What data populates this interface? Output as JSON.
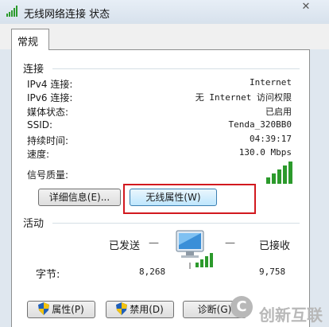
{
  "window": {
    "title": "无线网络连接 状态",
    "close_glyph": "✕"
  },
  "tabs": [
    {
      "label": "常规"
    }
  ],
  "connection": {
    "heading": "连接",
    "rows": [
      {
        "label": "IPv4 连接:",
        "value": "Internet"
      },
      {
        "label": "IPv6 连接:",
        "value": "无 Internet 访问权限"
      },
      {
        "label": "媒体状态:",
        "value": "已启用"
      },
      {
        "label": "SSID:",
        "value": "Tenda_320BB0"
      },
      {
        "label": "持续时间:",
        "value": "04:39:17"
      },
      {
        "label": "速度:",
        "value": "130.0 Mbps"
      }
    ],
    "signal_label": "信号质量:",
    "signal_bars": 5,
    "details_button": "详细信息(E)...",
    "wireless_properties_button": "无线属性(W)"
  },
  "activity": {
    "heading": "活动",
    "sent_label": "已发送",
    "received_label": "已接收",
    "bytes_label": "字节:",
    "bytes_sent": "8,268",
    "bytes_received": "9,758",
    "dash_left": "—",
    "dash_right": "—"
  },
  "buttons": {
    "properties": "属性(P)",
    "disable": "禁用(D)",
    "diagnose": "诊断(G)"
  },
  "watermark": {
    "text": "创新互联",
    "logo_glyph": "C"
  },
  "colors": {
    "highlight": "#d2191f",
    "signal": "#2c9a2c"
  }
}
